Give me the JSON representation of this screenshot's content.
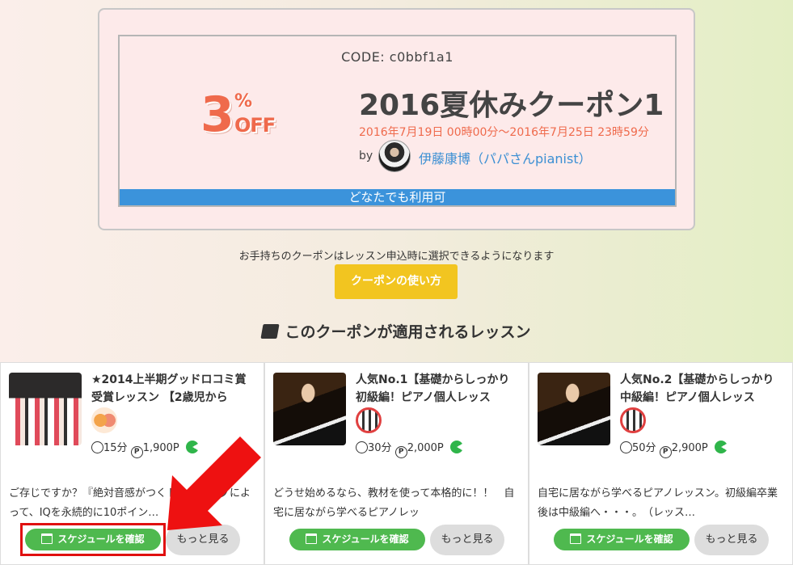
{
  "coupon": {
    "code": "CODE: c0bbf1a1",
    "discount_number": "3",
    "discount_sign": "%",
    "discount_off": "OFF",
    "title": "2016夏休みクーポン1",
    "period": "2016年7月19日 00時00分～2016年7月25日 23時59分",
    "by_label": "by",
    "author": "伊藤康博（パパさんpianist）",
    "availability": "どなたでも利用可"
  },
  "notice": "お手持ちのクーポンはレッスン申込時に選択できるようになります",
  "howto_button": "クーポンの使い方",
  "section_title": "このクーポンが適用されるレッスン",
  "lessons": [
    {
      "title": "★2014上半期グッドロコミ賞受賞レッスン 【2歳児から",
      "duration": "15分",
      "price": "1,900P",
      "description": "ご存じですか？『絶対音感がつくトレーニングによって、IQを永続的に10ポイン…",
      "schedule_label": "スケジュールを確認",
      "more_label": "もっと見る"
    },
    {
      "title": "人気No.1【基礎からしっかり初級編！ピアノ個人レッス",
      "duration": "30分",
      "price": "2,000P",
      "description": "どうせ始めるなら、教材を使って本格的に！！　自宅に居ながら学べるピアノレッ",
      "schedule_label": "スケジュールを確認",
      "more_label": "もっと見る"
    },
    {
      "title": "人気No.2【基礎からしっかり中級編！ピアノ個人レッス",
      "duration": "50分",
      "price": "2,900P",
      "description": "自宅に居ながら学べるピアノレッスン。初級編卒業後は中級編へ・・・。　（レッス…",
      "schedule_label": "スケジュールを確認",
      "more_label": "もっと見る"
    }
  ],
  "icons": {
    "point_glyph": "P",
    "clock_glyph": "◷"
  },
  "colors": {
    "accent_orange": "#ef6a4c",
    "bar_blue": "#3b93db",
    "howto_yellow": "#f2c520",
    "schedule_green": "#4fb94f",
    "highlight_red": "#e01010"
  }
}
